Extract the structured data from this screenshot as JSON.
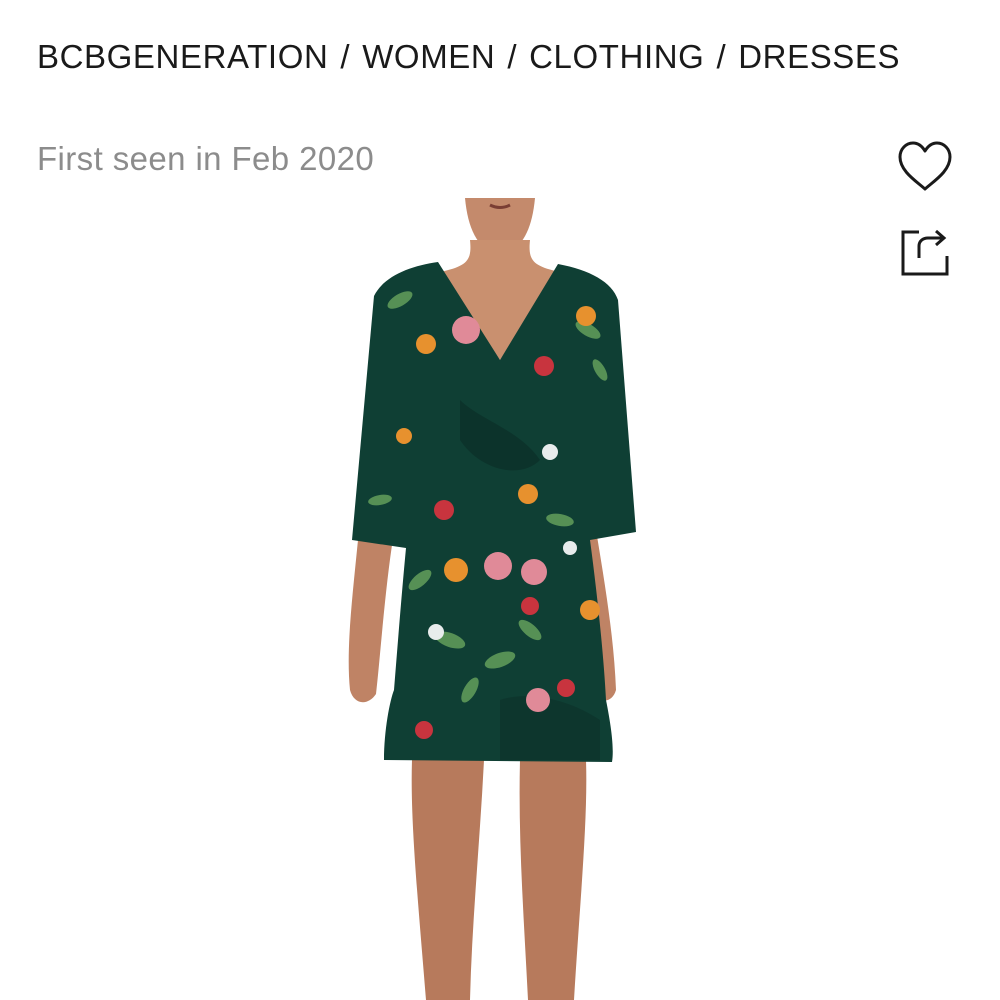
{
  "breadcrumb": {
    "items": [
      "BCBGENERATION",
      "WOMEN",
      "CLOTHING",
      "DRESSES"
    ],
    "separator": "/"
  },
  "first_seen": "First seen in Feb 2020",
  "actions": {
    "favorite_icon": "heart-icon",
    "share_icon": "share-icon"
  },
  "product_image": {
    "icon": "floral-dress-photo",
    "dress_color": "#0f3f34"
  }
}
